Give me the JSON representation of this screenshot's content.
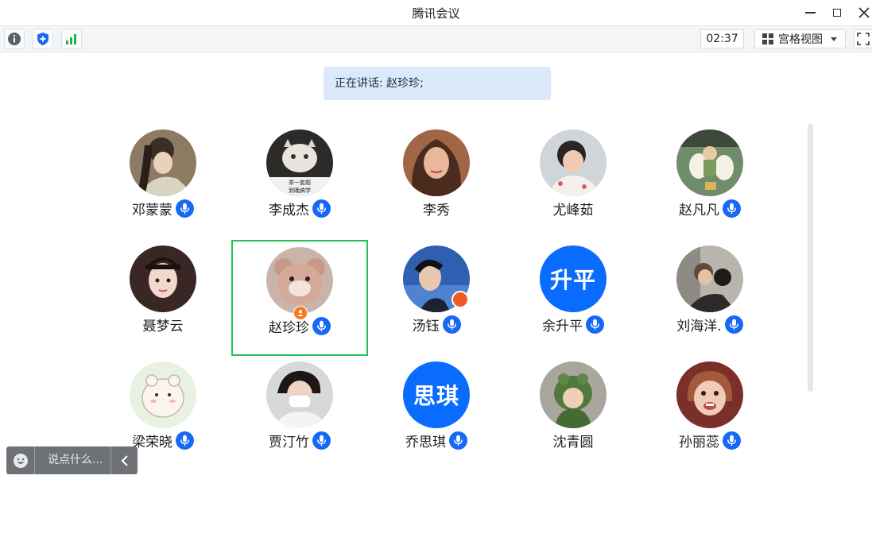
{
  "window": {
    "title": "腾讯会议"
  },
  "toolbar": {
    "timer": "02:37",
    "view_label": "宫格视图"
  },
  "speaking_banner": "正在讲话: 赵珍珍;",
  "participants": [
    {
      "name": "邓蒙蒙",
      "mic": true
    },
    {
      "name": "李成杰",
      "mic": true
    },
    {
      "name": "李秀",
      "mic": false
    },
    {
      "name": "尤峰茹",
      "mic": false
    },
    {
      "name": "赵凡凡",
      "mic": true
    },
    {
      "name": "聂梦云",
      "mic": false
    },
    {
      "name": "赵珍珍",
      "mic": true,
      "active": true,
      "host": true
    },
    {
      "name": "汤钰",
      "mic": true
    },
    {
      "name": "余升平",
      "mic": true,
      "avatar_text": "升平"
    },
    {
      "name": "刘海洋.",
      "mic": true
    },
    {
      "name": "梁荣晓",
      "mic": true
    },
    {
      "name": "贾汀竹",
      "mic": true
    },
    {
      "name": "乔思琪",
      "mic": true,
      "avatar_text": "思琪"
    },
    {
      "name": "沈青圆",
      "mic": false
    },
    {
      "name": "孙丽蕊",
      "mic": true
    }
  ],
  "avatar_photo_text": "茶一套题\n到晚搞学",
  "chat": {
    "placeholder": "说点什么..."
  },
  "colors": {
    "accent": "#1668f5",
    "active_border": "#21c256",
    "banner": "#dbe9fb"
  }
}
